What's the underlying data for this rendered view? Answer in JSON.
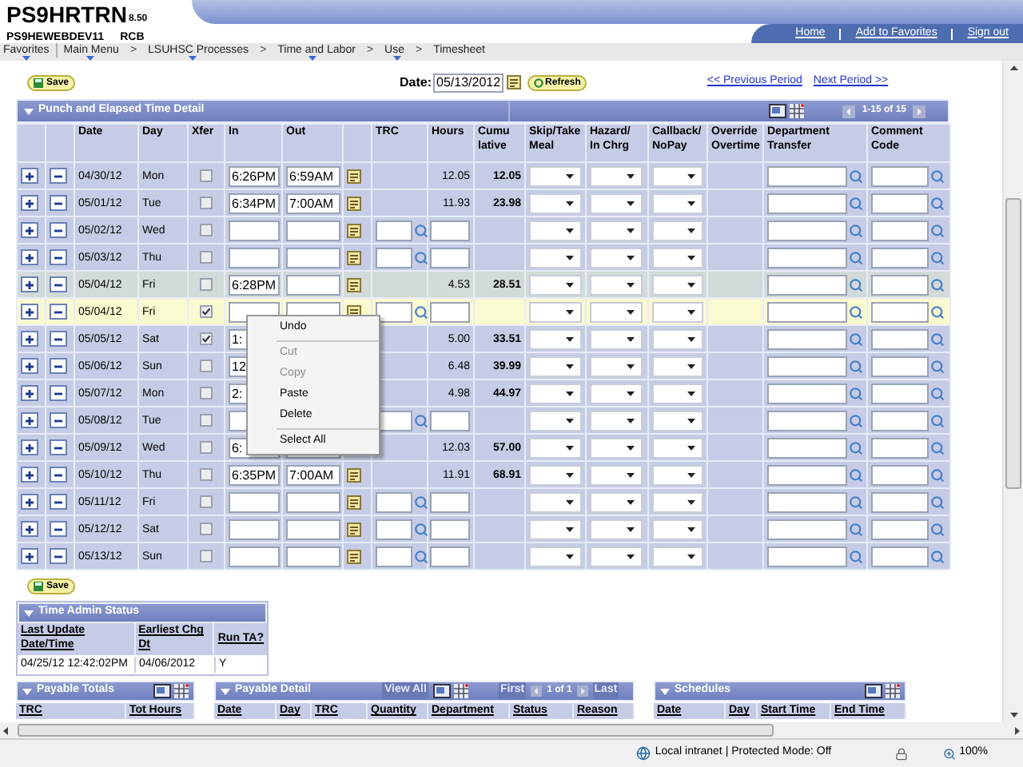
{
  "header": {
    "app_title": "PS9HRTRN",
    "version": "8.50",
    "server": "PS9HEWEBDEV11",
    "user": "RCB",
    "links": [
      "Home",
      "Add to Favorites",
      "Sign out"
    ]
  },
  "breadcrumb": [
    {
      "label": "Favorites",
      "menu": true
    },
    {
      "label": "Main Menu",
      "menu": true,
      "separator": ">"
    },
    {
      "label": "LSUHSC Processes",
      "menu": true,
      "separator": ">"
    },
    {
      "label": "Time and Labor",
      "menu": true,
      "separator": ">"
    },
    {
      "label": "Use",
      "menu": true,
      "separator": ">"
    },
    {
      "label": "Timesheet",
      "menu": false
    }
  ],
  "toolbar": {
    "save": "Save",
    "date_label": "Date:",
    "date": "05/13/2012",
    "refresh": "Refresh",
    "previous": "<< Previous Period",
    "next": "Next Period >>"
  },
  "punch_grid": {
    "title": "Punch and Elapsed Time Detail",
    "count": "1-15 of 15",
    "columns": [
      "Date",
      "Day",
      "Xfer",
      "In",
      "Out",
      "TRC",
      "Hours",
      "Cumu\nlative",
      "Skip/Take\nMeal",
      "Hazard/\nIn Chrg",
      "Callback/\nNoPay",
      "Override\nOvertime",
      "Department\nTransfer",
      "Comment\nCode"
    ],
    "rows": [
      {
        "date": "04/30/12",
        "day": "Mon",
        "xfer": false,
        "in": "6:26PM",
        "out": "6:59AM",
        "kind": "punch",
        "hours": "12.05",
        "cumulative": "12.05",
        "selected": false,
        "hovered": false
      },
      {
        "date": "05/01/12",
        "day": "Tue",
        "xfer": false,
        "in": "6:34PM",
        "out": "7:00AM",
        "kind": "punch",
        "hours": "11.93",
        "cumulative": "23.98",
        "selected": false,
        "hovered": false
      },
      {
        "date": "05/02/12",
        "day": "Wed",
        "xfer": false,
        "kind": "entry",
        "selected": false,
        "hovered": false
      },
      {
        "date": "05/03/12",
        "day": "Thu",
        "xfer": false,
        "kind": "entry",
        "selected": false,
        "hovered": false
      },
      {
        "date": "05/04/12",
        "day": "Fri",
        "xfer": false,
        "in": "6:28PM",
        "kind": "punch",
        "hours": "4.53",
        "cumulative": "28.51",
        "selected": false,
        "hovered": true
      },
      {
        "date": "05/04/12",
        "day": "Fri",
        "xfer": true,
        "kind": "entry",
        "selected": true,
        "hovered": false
      },
      {
        "date": "05/05/12",
        "day": "Sat",
        "xfer": true,
        "in": "1:",
        "kind": "punch",
        "hours": "5.00",
        "cumulative": "33.51",
        "selected": false,
        "hovered": false
      },
      {
        "date": "05/06/12",
        "day": "Sun",
        "xfer": false,
        "in": "12",
        "kind": "punch",
        "hours": "6.48",
        "cumulative": "39.99",
        "selected": false,
        "hovered": false
      },
      {
        "date": "05/07/12",
        "day": "Mon",
        "xfer": false,
        "in": "2:",
        "kind": "punch",
        "hours": "4.98",
        "cumulative": "44.97",
        "selected": false,
        "hovered": false
      },
      {
        "date": "05/08/12",
        "day": "Tue",
        "xfer": false,
        "kind": "entry",
        "selected": false,
        "hovered": false
      },
      {
        "date": "05/09/12",
        "day": "Wed",
        "xfer": false,
        "in": "6:",
        "kind": "punch",
        "hours": "12.03",
        "cumulative": "57.00",
        "selected": false,
        "hovered": false
      },
      {
        "date": "05/10/12",
        "day": "Thu",
        "xfer": false,
        "in": "6:35PM",
        "out": "7:00AM",
        "kind": "punch",
        "hours": "11.91",
        "cumulative": "68.91",
        "selected": false,
        "hovered": false
      },
      {
        "date": "05/11/12",
        "day": "Fri",
        "xfer": false,
        "kind": "entry",
        "selected": false,
        "hovered": false
      },
      {
        "date": "05/12/12",
        "day": "Sat",
        "xfer": false,
        "kind": "entry",
        "selected": false,
        "hovered": false
      },
      {
        "date": "05/13/12",
        "day": "Sun",
        "xfer": false,
        "kind": "entry",
        "selected": false,
        "hovered": false
      }
    ]
  },
  "context_menu": {
    "items": [
      {
        "label": "Undo",
        "disabled": false,
        "separator_after": true
      },
      {
        "label": "Cut",
        "disabled": true,
        "separator_after": false
      },
      {
        "label": "Copy",
        "disabled": true,
        "separator_after": false
      },
      {
        "label": "Paste",
        "disabled": false,
        "separator_after": false
      },
      {
        "label": "Delete",
        "disabled": false,
        "separator_after": true
      },
      {
        "label": "Select All",
        "disabled": false,
        "separator_after": false
      }
    ]
  },
  "save_bottom": "Save",
  "time_admin": {
    "title": "Time Admin Status",
    "columns": [
      "Last Update\nDate/Time",
      "Earliest Chg\nDt",
      "Run TA?"
    ],
    "values": [
      "04/25/12 12:42:02PM",
      "04/06/2012",
      "Y"
    ]
  },
  "payable_totals": {
    "title": "Payable Totals",
    "columns": [
      "TRC",
      "Tot Hours"
    ]
  },
  "payable_detail": {
    "title": "Payable Detail",
    "view_all": "View All",
    "first": "First",
    "count": "1 of 1",
    "last": "Last",
    "columns": [
      "Date",
      "Day",
      "TRC",
      "Quantity",
      "Department",
      "Status",
      "Reason"
    ]
  },
  "schedules": {
    "title": "Schedules",
    "columns": [
      "Date",
      "Day",
      "Start Time",
      "End Time"
    ]
  },
  "status_bar": {
    "zone": "Local intranet | Protected Mode: Off",
    "zoom": "100%"
  }
}
